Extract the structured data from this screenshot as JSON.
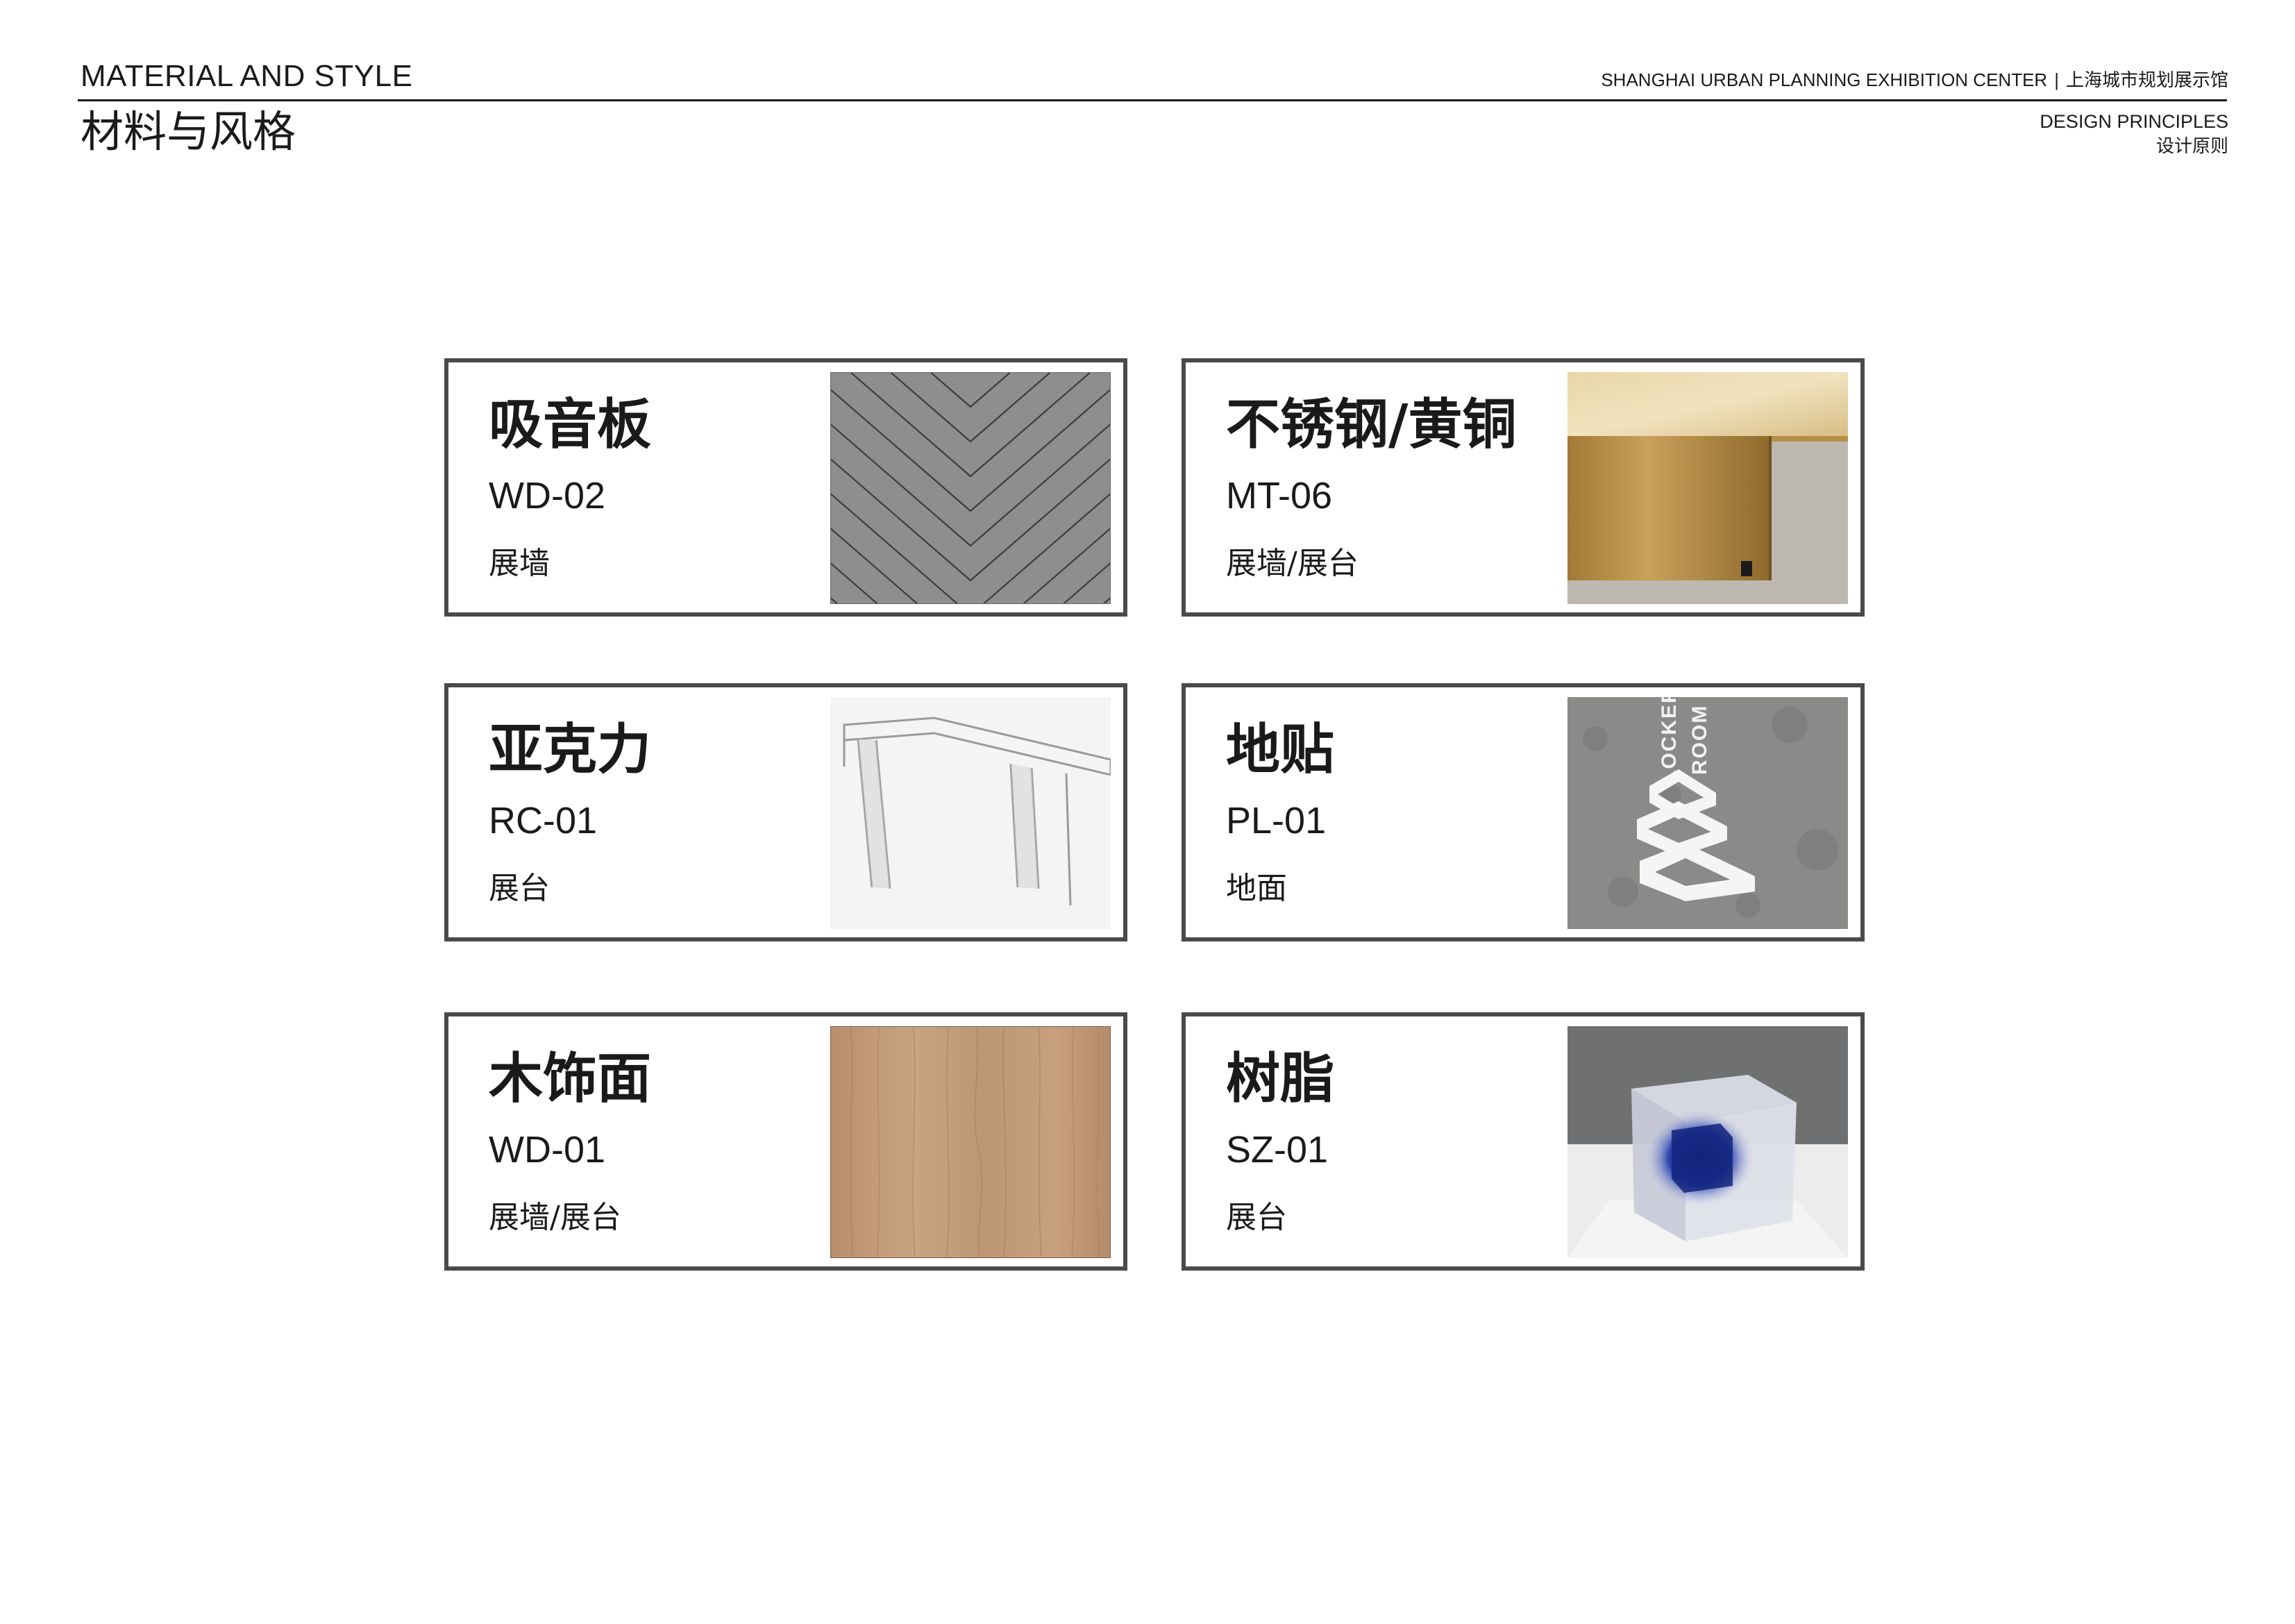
{
  "header": {
    "title_en": "MATERIAL AND STYLE",
    "title_cn": "材料与风格",
    "project_en": "SHANGHAI URBAN PLANNING EXHIBITION CENTER",
    "separator": "|",
    "project_cn": "上海城市规划展示馆",
    "section_en": "DESIGN PRINCIPLES",
    "section_cn": "设计原则"
  },
  "materials": [
    {
      "name": "吸音板",
      "code": "WD-02",
      "usage": "展墙",
      "swatch": "acoustic-panel-chevron-icon"
    },
    {
      "name": "不锈钢/黄铜",
      "code": "MT-06",
      "usage": "展墙/展台",
      "swatch": "brass-table-icon"
    },
    {
      "name": "亚克力",
      "code": "RC-01",
      "usage": "展台",
      "swatch": "acrylic-table-icon"
    },
    {
      "name": "地贴",
      "code": "PL-01",
      "usage": "地面",
      "swatch": "floor-decal-icon",
      "decal_text": [
        "LOCKER",
        "ROOM"
      ]
    },
    {
      "name": "木饰面",
      "code": "WD-01",
      "usage": "展墙/展台",
      "swatch": "wood-veneer-icon"
    },
    {
      "name": "树脂",
      "code": "SZ-01",
      "usage": "展台",
      "swatch": "resin-cube-icon"
    }
  ],
  "colors": {
    "card_border": "#4a4a4a",
    "acoustic_gray": "#8e8e8e",
    "brass": "#c9a15a",
    "concrete": "#8a8a88",
    "wood": "#c19a78",
    "resin_blue": "#1b2f8a"
  }
}
